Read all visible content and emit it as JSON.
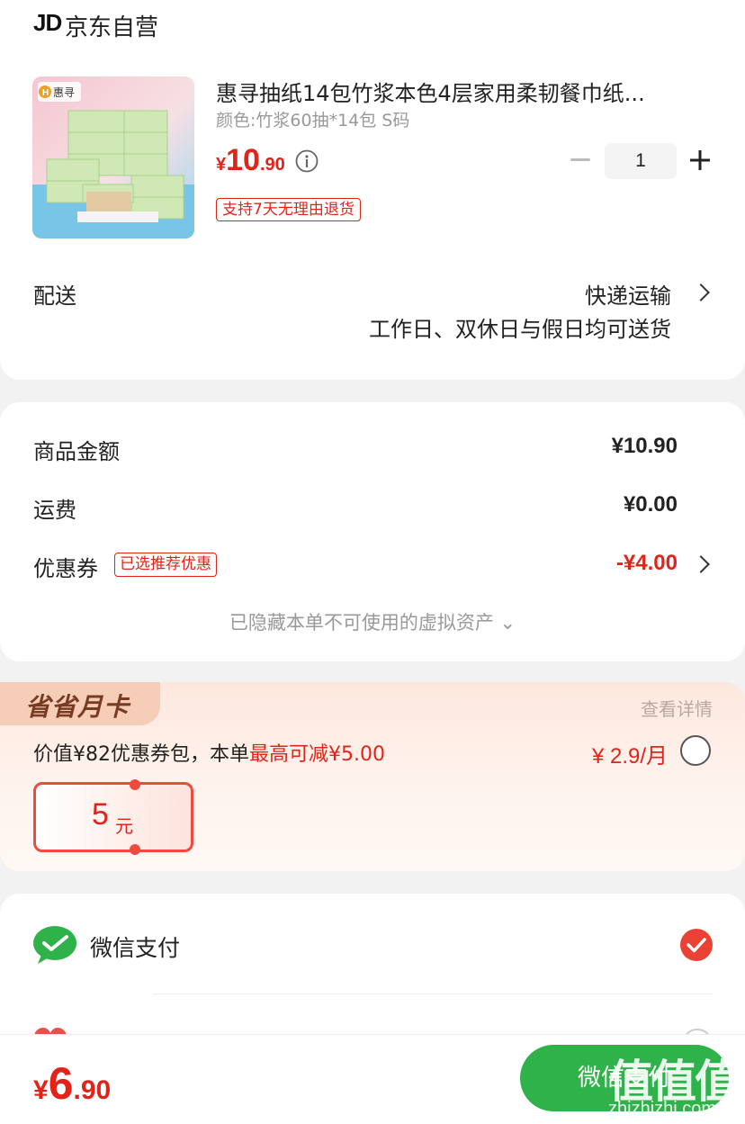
{
  "store": {
    "logo_text": "JD",
    "name": "京东自营"
  },
  "product": {
    "title": "惠寻抽纸14包竹浆本色4层家用柔韧餐巾纸...",
    "spec": "颜色:竹浆60抽*14包 S码",
    "price_currency": "¥",
    "price_int": "10",
    "price_dec": ".90",
    "quantity": "1",
    "return_tag": "支持7天无理由退货",
    "image_brand": "惠寻"
  },
  "delivery": {
    "label": "配送",
    "method": "快递运输",
    "note": "工作日、双休日与假日均可送货"
  },
  "summary": {
    "goods_label": "商品金额",
    "goods_value": "¥10.90",
    "shipping_label": "运费",
    "shipping_value": "¥0.00",
    "coupon_label": "优惠券",
    "coupon_tag": "已选推荐优惠",
    "coupon_value": "-¥4.00",
    "hidden_assets": "已隐藏本单不可使用的虚拟资产 ⌄"
  },
  "monthly_card": {
    "badge": "省省月卡",
    "detail_link": "查看详情",
    "desc_prefix": "价值¥82优惠券包，本单",
    "desc_highlight": "最高可减¥5.00",
    "price": "¥ 2.9/月",
    "voucher_amount": "5",
    "voucher_unit": "元"
  },
  "payment": {
    "wechat_label": "微信支付",
    "wechat_selected": true
  },
  "bottom": {
    "total_currency": "¥",
    "total_int": "6",
    "total_dec": ".90",
    "pay_button": "微信支付",
    "watermark": "值值值",
    "watermark_url": "zhizhizhi.com"
  },
  "colors": {
    "accent_red": "#e2231a",
    "wechat_green": "#2fb24a",
    "monthly_bg": "#fde8dd"
  },
  "icons": [
    "info-icon",
    "minus-icon",
    "plus-icon",
    "chevron-right-icon",
    "wechat-icon",
    "checked-circle-icon",
    "radio-icon"
  ]
}
